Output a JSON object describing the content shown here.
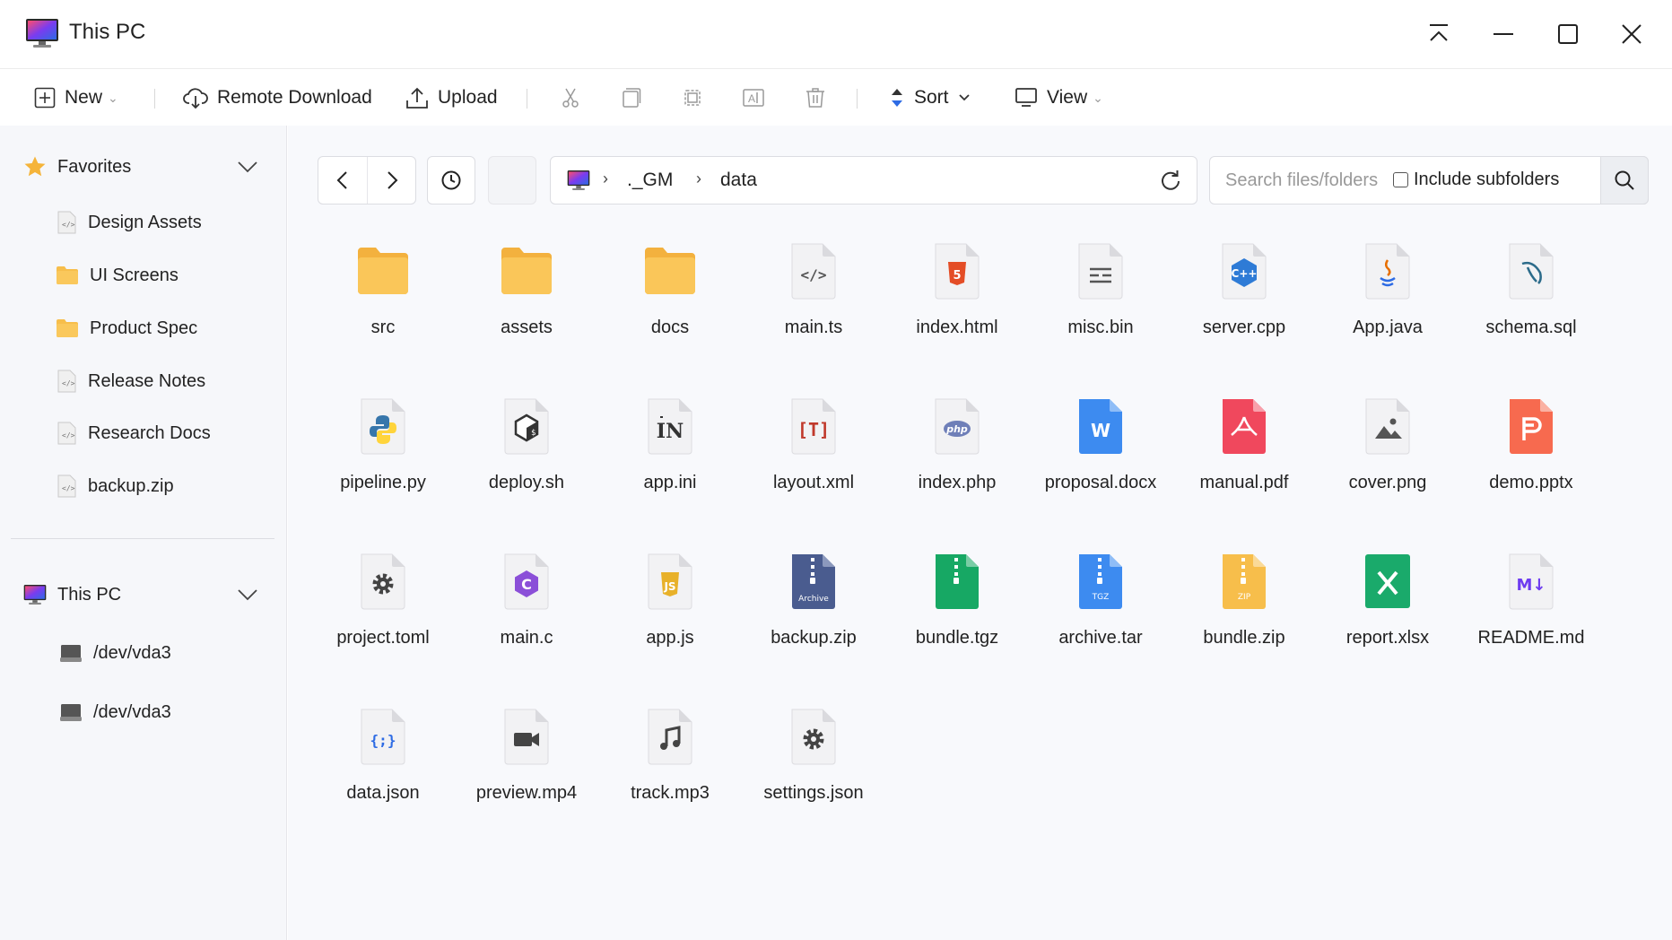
{
  "window": {
    "title": "This PC",
    "controls": [
      "collapse",
      "minimize",
      "maximize",
      "close"
    ]
  },
  "toolbar": {
    "new_label": "New",
    "remote_download_label": "Remote Download",
    "upload_label": "Upload",
    "sort_label": "Sort",
    "view_label": "View"
  },
  "sidebar": {
    "favorites_label": "Favorites",
    "favorites": [
      {
        "label": "Design Assets",
        "icon": "file-code-icon"
      },
      {
        "label": "UI Screens",
        "icon": "folder-icon"
      },
      {
        "label": "Product Spec",
        "icon": "folder-icon"
      },
      {
        "label": "Release Notes",
        "icon": "file-code-icon"
      },
      {
        "label": "Research Docs",
        "icon": "file-code-icon"
      },
      {
        "label": "backup.zip",
        "icon": "file-code-icon"
      }
    ],
    "thispc_label": "This PC",
    "drives": [
      {
        "label": "/dev/vda3"
      },
      {
        "label": "/dev/vda3"
      }
    ]
  },
  "path": {
    "crumbs": [
      "._GM",
      "data"
    ]
  },
  "search": {
    "placeholder": "Search files/folders",
    "include_subfolders_label": "Include subfolders"
  },
  "files": [
    {
      "name": "src",
      "type": "folder"
    },
    {
      "name": "assets",
      "type": "folder"
    },
    {
      "name": "docs",
      "type": "folder"
    },
    {
      "name": "main.ts",
      "type": "code"
    },
    {
      "name": "index.html",
      "type": "html"
    },
    {
      "name": "misc.bin",
      "type": "text"
    },
    {
      "name": "server.cpp",
      "type": "cpp"
    },
    {
      "name": "App.java",
      "type": "java"
    },
    {
      "name": "schema.sql",
      "type": "sql"
    },
    {
      "name": "pipeline.py",
      "type": "python"
    },
    {
      "name": "deploy.sh",
      "type": "shell"
    },
    {
      "name": "app.ini",
      "type": "ini"
    },
    {
      "name": "layout.xml",
      "type": "xml"
    },
    {
      "name": "index.php",
      "type": "php"
    },
    {
      "name": "proposal.docx",
      "type": "word"
    },
    {
      "name": "manual.pdf",
      "type": "pdf"
    },
    {
      "name": "cover.png",
      "type": "image"
    },
    {
      "name": "demo.pptx",
      "type": "ppt"
    },
    {
      "name": "project.toml",
      "type": "gear"
    },
    {
      "name": "main.c",
      "type": "c"
    },
    {
      "name": "app.js",
      "type": "js"
    },
    {
      "name": "backup.zip",
      "type": "archive",
      "badge": "Archive"
    },
    {
      "name": "bundle.tgz",
      "type": "tgz-green"
    },
    {
      "name": "archive.tar",
      "type": "tgz-blue",
      "badge": "TGZ"
    },
    {
      "name": "bundle.zip",
      "type": "zip",
      "badge": "ZIP"
    },
    {
      "name": "report.xlsx",
      "type": "excel"
    },
    {
      "name": "README.md",
      "type": "markdown"
    },
    {
      "name": "data.json",
      "type": "json"
    },
    {
      "name": "preview.mp4",
      "type": "video"
    },
    {
      "name": "track.mp3",
      "type": "audio"
    },
    {
      "name": "settings.json",
      "type": "gear"
    }
  ],
  "colors": {
    "folder": "#F7BE4B",
    "accent_blue": "#2D6BE4",
    "sidebar_bg": "#F6F7FA",
    "main_bg": "#F8F9FC"
  }
}
